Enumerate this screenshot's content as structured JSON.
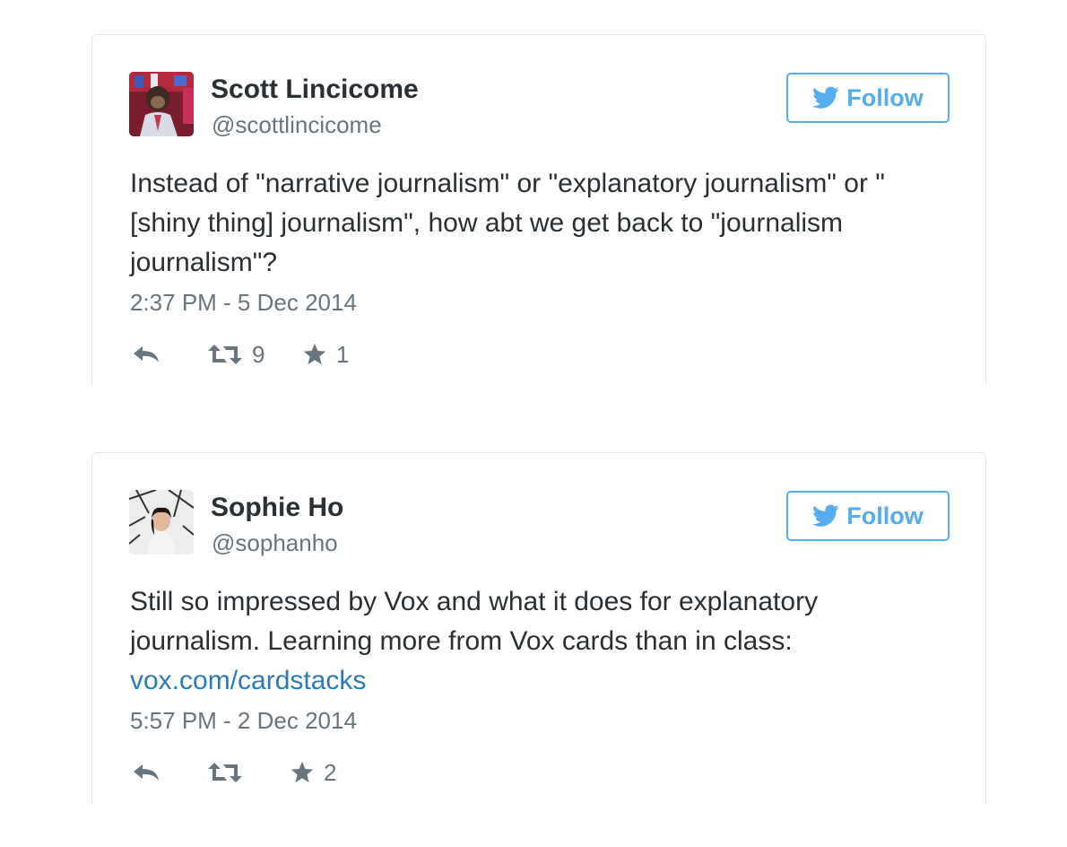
{
  "tweets": [
    {
      "author_name": "Scott Lincicome",
      "author_handle": "@scottlincicome",
      "follow_label": "Follow",
      "text": "Instead of \"narrative journalism\" or \"explanatory journalism\" or \"[shiny thing] journalism\", how abt we get back to \"journalism journalism\"?",
      "link": "",
      "timestamp": "2:37 PM - 5 Dec 2014",
      "retweet_count": "9",
      "favorite_count": "1"
    },
    {
      "author_name": "Sophie Ho",
      "author_handle": "@sophanho",
      "follow_label": "Follow",
      "text": "Still so impressed by Vox and what it does for explanatory journalism. Learning more from Vox cards than in class:",
      "link": "vox.com/cardstacks",
      "timestamp": "5:57 PM - 2 Dec 2014",
      "retweet_count": "",
      "favorite_count": "2"
    }
  ],
  "icons": {
    "follow": "twitter-bird-icon",
    "reply": "reply-icon",
    "retweet": "retweet-icon",
    "favorite": "star-icon"
  },
  "colors": {
    "accent": "#55acee",
    "link": "#2b7bb9",
    "text": "#292f33",
    "secondary_text": "#66757f",
    "action_icon": "#8899a6",
    "border": "#e1e8ed"
  }
}
